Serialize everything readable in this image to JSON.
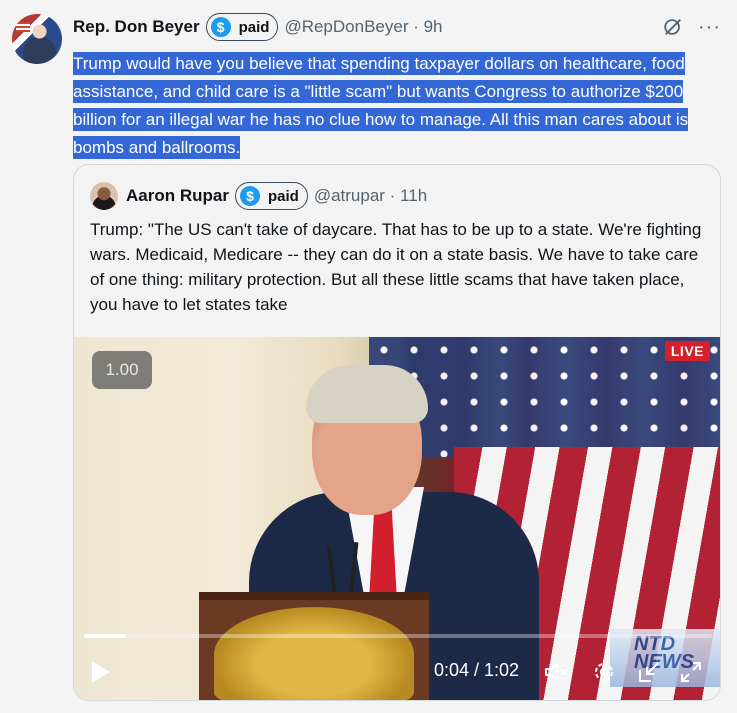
{
  "post": {
    "author_name": "Rep. Don Beyer",
    "badge_icon": "$",
    "badge_label": "paid",
    "handle_time": "@RepDonBeyer · 9h",
    "text": "Trump would have you believe that spending taxpayer dollars on healthcare, food assistance, and child care is a \"little scam\" but wants Congress to authorize $200 billion for an illegal war he has no clue how to manage. All this man cares about is bombs and ballrooms.",
    "icons": [
      "grok-icon",
      "more-icon"
    ],
    "more_glyph": "···"
  },
  "quote": {
    "author_name": "Aaron Rupar",
    "badge_icon": "$",
    "badge_label": "paid",
    "handle_time": "@atrupar · 11h",
    "text": "Trump: \"The US can't take of daycare. That has to be up to a state. We're fighting wars. Medicaid, Medicare -- they can do it on a state basis. We have to take care of one thing: military protection. But all these little scams that have taken place, you have to let states take"
  },
  "video": {
    "speed": "1.00",
    "live_label": "LIVE",
    "network_logo": "NTD NEWS",
    "current_time": "0:04",
    "duration": "1:02",
    "time_display": "0:04 / 1:02",
    "progress_fraction": 0.065,
    "accent_color": "#d6202a",
    "controls": [
      "play-icon",
      "mute-icon",
      "settings-icon",
      "minimize-icon",
      "fullscreen-icon"
    ]
  },
  "colors": {
    "highlight": "#3367d6",
    "verified_badge": "#1d9bf0",
    "handle": "#536471",
    "border": "#cfd9de"
  }
}
